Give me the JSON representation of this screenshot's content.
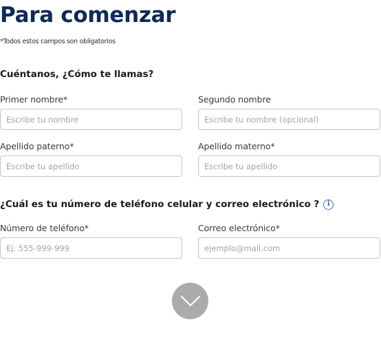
{
  "header": {
    "title": "Para comenzar",
    "required_note": "*Todos estos campos son obligatorios"
  },
  "name_section": {
    "title": "Cuéntanos, ¿Cómo te llamas?",
    "fields": {
      "first_name": {
        "label": "Primer nombre*",
        "placeholder": "Escribe tu nombre",
        "value": ""
      },
      "middle_name": {
        "label": "Segundo nombre",
        "placeholder": "Escribe tu nombre (opcional)",
        "value": ""
      },
      "paternal_surname": {
        "label": "Apellido paterno*",
        "placeholder": "Escribe tu apellido",
        "value": ""
      },
      "maternal_surname": {
        "label": "Apellido materno*",
        "placeholder": "Escribe tu apellido",
        "value": ""
      }
    }
  },
  "contact_section": {
    "title": "¿Cuál es tu número de teléfono celular y correo electrónico ?",
    "info_icon": "info-icon",
    "fields": {
      "phone": {
        "label": "Número de teléfono*",
        "placeholder": "Ej. 555-999-999",
        "value": ""
      },
      "email": {
        "label": "Correo electrónico*",
        "placeholder": "ejemplo@mail.com",
        "value": ""
      }
    }
  },
  "scroll_button": {
    "icon": "chevron-down-icon"
  },
  "colors": {
    "title": "#0d2a57",
    "info_icon": "#2f6fd6",
    "scroll_button": "#ababab",
    "input_border": "#c4c4c4"
  }
}
